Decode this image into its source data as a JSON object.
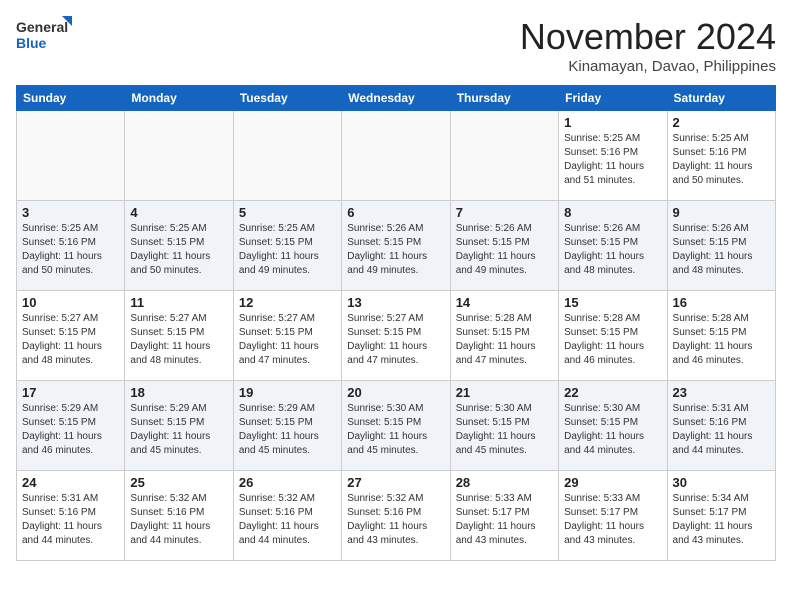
{
  "header": {
    "logo_line1": "General",
    "logo_line2": "Blue",
    "month": "November 2024",
    "location": "Kinamayan, Davao, Philippines"
  },
  "weekdays": [
    "Sunday",
    "Monday",
    "Tuesday",
    "Wednesday",
    "Thursday",
    "Friday",
    "Saturday"
  ],
  "weeks": [
    [
      {
        "day": "",
        "info": ""
      },
      {
        "day": "",
        "info": ""
      },
      {
        "day": "",
        "info": ""
      },
      {
        "day": "",
        "info": ""
      },
      {
        "day": "",
        "info": ""
      },
      {
        "day": "1",
        "info": "Sunrise: 5:25 AM\nSunset: 5:16 PM\nDaylight: 11 hours\nand 51 minutes."
      },
      {
        "day": "2",
        "info": "Sunrise: 5:25 AM\nSunset: 5:16 PM\nDaylight: 11 hours\nand 50 minutes."
      }
    ],
    [
      {
        "day": "3",
        "info": "Sunrise: 5:25 AM\nSunset: 5:16 PM\nDaylight: 11 hours\nand 50 minutes."
      },
      {
        "day": "4",
        "info": "Sunrise: 5:25 AM\nSunset: 5:15 PM\nDaylight: 11 hours\nand 50 minutes."
      },
      {
        "day": "5",
        "info": "Sunrise: 5:25 AM\nSunset: 5:15 PM\nDaylight: 11 hours\nand 49 minutes."
      },
      {
        "day": "6",
        "info": "Sunrise: 5:26 AM\nSunset: 5:15 PM\nDaylight: 11 hours\nand 49 minutes."
      },
      {
        "day": "7",
        "info": "Sunrise: 5:26 AM\nSunset: 5:15 PM\nDaylight: 11 hours\nand 49 minutes."
      },
      {
        "day": "8",
        "info": "Sunrise: 5:26 AM\nSunset: 5:15 PM\nDaylight: 11 hours\nand 48 minutes."
      },
      {
        "day": "9",
        "info": "Sunrise: 5:26 AM\nSunset: 5:15 PM\nDaylight: 11 hours\nand 48 minutes."
      }
    ],
    [
      {
        "day": "10",
        "info": "Sunrise: 5:27 AM\nSunset: 5:15 PM\nDaylight: 11 hours\nand 48 minutes."
      },
      {
        "day": "11",
        "info": "Sunrise: 5:27 AM\nSunset: 5:15 PM\nDaylight: 11 hours\nand 48 minutes."
      },
      {
        "day": "12",
        "info": "Sunrise: 5:27 AM\nSunset: 5:15 PM\nDaylight: 11 hours\nand 47 minutes."
      },
      {
        "day": "13",
        "info": "Sunrise: 5:27 AM\nSunset: 5:15 PM\nDaylight: 11 hours\nand 47 minutes."
      },
      {
        "day": "14",
        "info": "Sunrise: 5:28 AM\nSunset: 5:15 PM\nDaylight: 11 hours\nand 47 minutes."
      },
      {
        "day": "15",
        "info": "Sunrise: 5:28 AM\nSunset: 5:15 PM\nDaylight: 11 hours\nand 46 minutes."
      },
      {
        "day": "16",
        "info": "Sunrise: 5:28 AM\nSunset: 5:15 PM\nDaylight: 11 hours\nand 46 minutes."
      }
    ],
    [
      {
        "day": "17",
        "info": "Sunrise: 5:29 AM\nSunset: 5:15 PM\nDaylight: 11 hours\nand 46 minutes."
      },
      {
        "day": "18",
        "info": "Sunrise: 5:29 AM\nSunset: 5:15 PM\nDaylight: 11 hours\nand 45 minutes."
      },
      {
        "day": "19",
        "info": "Sunrise: 5:29 AM\nSunset: 5:15 PM\nDaylight: 11 hours\nand 45 minutes."
      },
      {
        "day": "20",
        "info": "Sunrise: 5:30 AM\nSunset: 5:15 PM\nDaylight: 11 hours\nand 45 minutes."
      },
      {
        "day": "21",
        "info": "Sunrise: 5:30 AM\nSunset: 5:15 PM\nDaylight: 11 hours\nand 45 minutes."
      },
      {
        "day": "22",
        "info": "Sunrise: 5:30 AM\nSunset: 5:15 PM\nDaylight: 11 hours\nand 44 minutes."
      },
      {
        "day": "23",
        "info": "Sunrise: 5:31 AM\nSunset: 5:16 PM\nDaylight: 11 hours\nand 44 minutes."
      }
    ],
    [
      {
        "day": "24",
        "info": "Sunrise: 5:31 AM\nSunset: 5:16 PM\nDaylight: 11 hours\nand 44 minutes."
      },
      {
        "day": "25",
        "info": "Sunrise: 5:32 AM\nSunset: 5:16 PM\nDaylight: 11 hours\nand 44 minutes."
      },
      {
        "day": "26",
        "info": "Sunrise: 5:32 AM\nSunset: 5:16 PM\nDaylight: 11 hours\nand 44 minutes."
      },
      {
        "day": "27",
        "info": "Sunrise: 5:32 AM\nSunset: 5:16 PM\nDaylight: 11 hours\nand 43 minutes."
      },
      {
        "day": "28",
        "info": "Sunrise: 5:33 AM\nSunset: 5:17 PM\nDaylight: 11 hours\nand 43 minutes."
      },
      {
        "day": "29",
        "info": "Sunrise: 5:33 AM\nSunset: 5:17 PM\nDaylight: 11 hours\nand 43 minutes."
      },
      {
        "day": "30",
        "info": "Sunrise: 5:34 AM\nSunset: 5:17 PM\nDaylight: 11 hours\nand 43 minutes."
      }
    ]
  ]
}
